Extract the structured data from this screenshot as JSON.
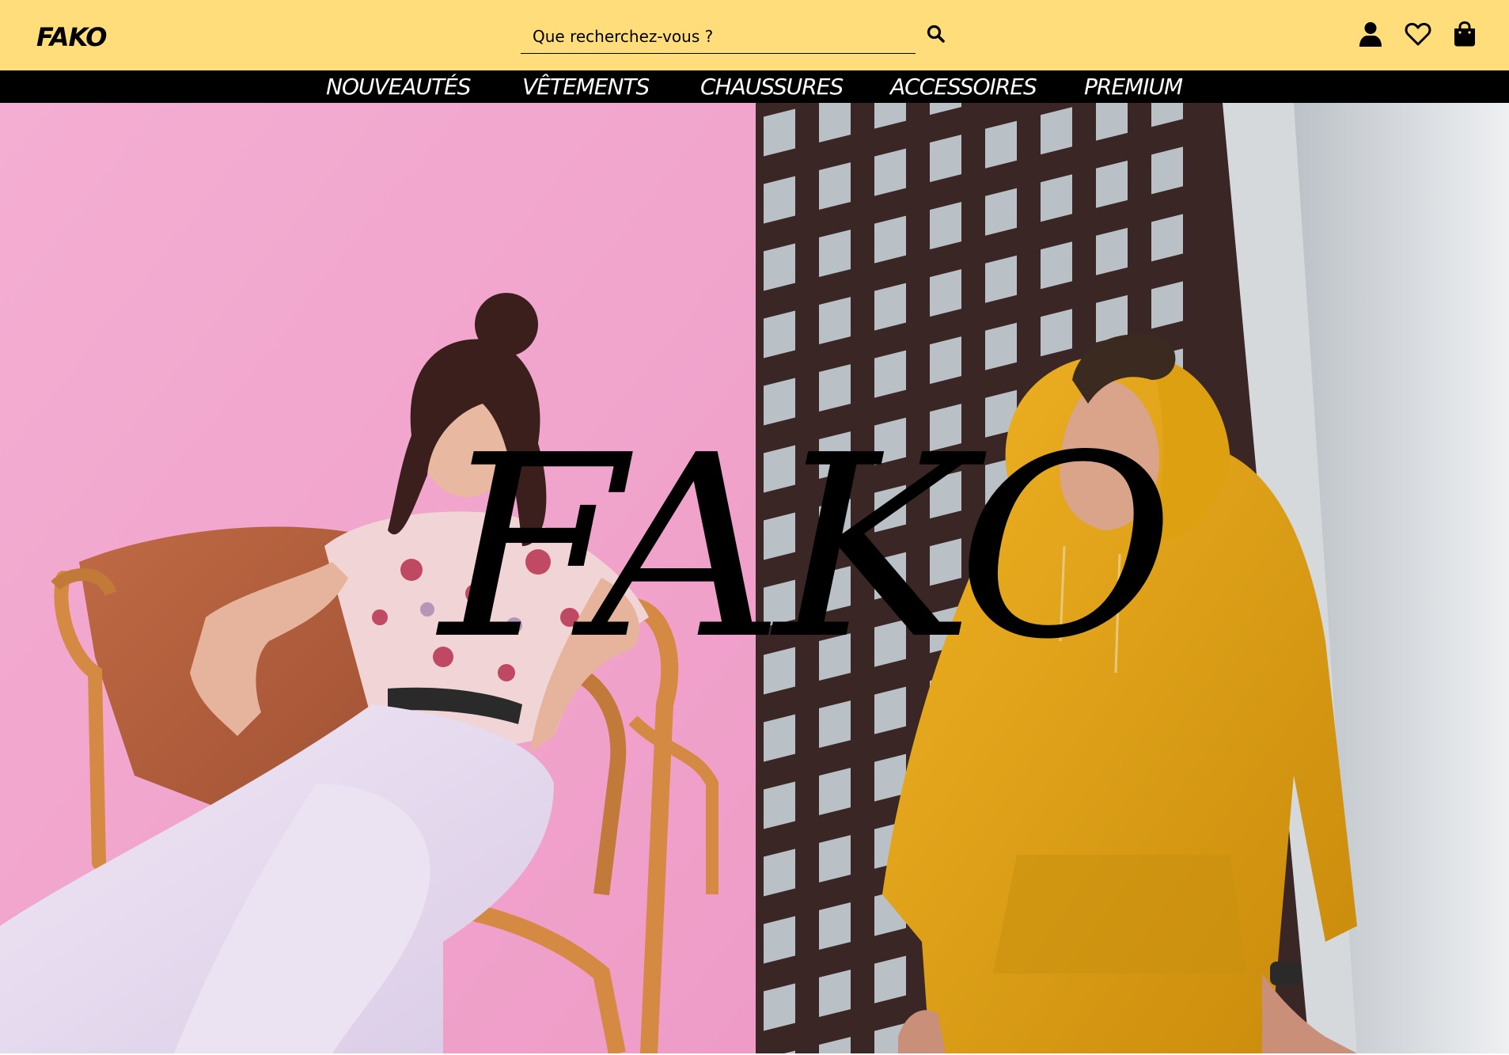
{
  "header": {
    "logo": "FAKO",
    "search_placeholder": "Que recherchez-vous ?",
    "search_icon": "search-icon",
    "icons": [
      "user-icon",
      "heart-icon",
      "shopping-bag-icon"
    ],
    "background_color": "#ffdd7a"
  },
  "nav": {
    "items": [
      {
        "label": "NOUVEAUTÉS"
      },
      {
        "label": "VÊTEMENTS"
      },
      {
        "label": "CHAUSSURES"
      },
      {
        "label": "ACCESSOIRES"
      },
      {
        "label": "PREMIUM"
      }
    ],
    "background_color": "#000000",
    "text_color": "#ffffff"
  },
  "hero": {
    "brand_text": "FAKO",
    "left_image": "woman-on-chair-pink-background",
    "right_image": "man-yellow-hoodie-building",
    "left_bg_color": "#f2a6cd",
    "right_accent_color": "#e6a614"
  }
}
